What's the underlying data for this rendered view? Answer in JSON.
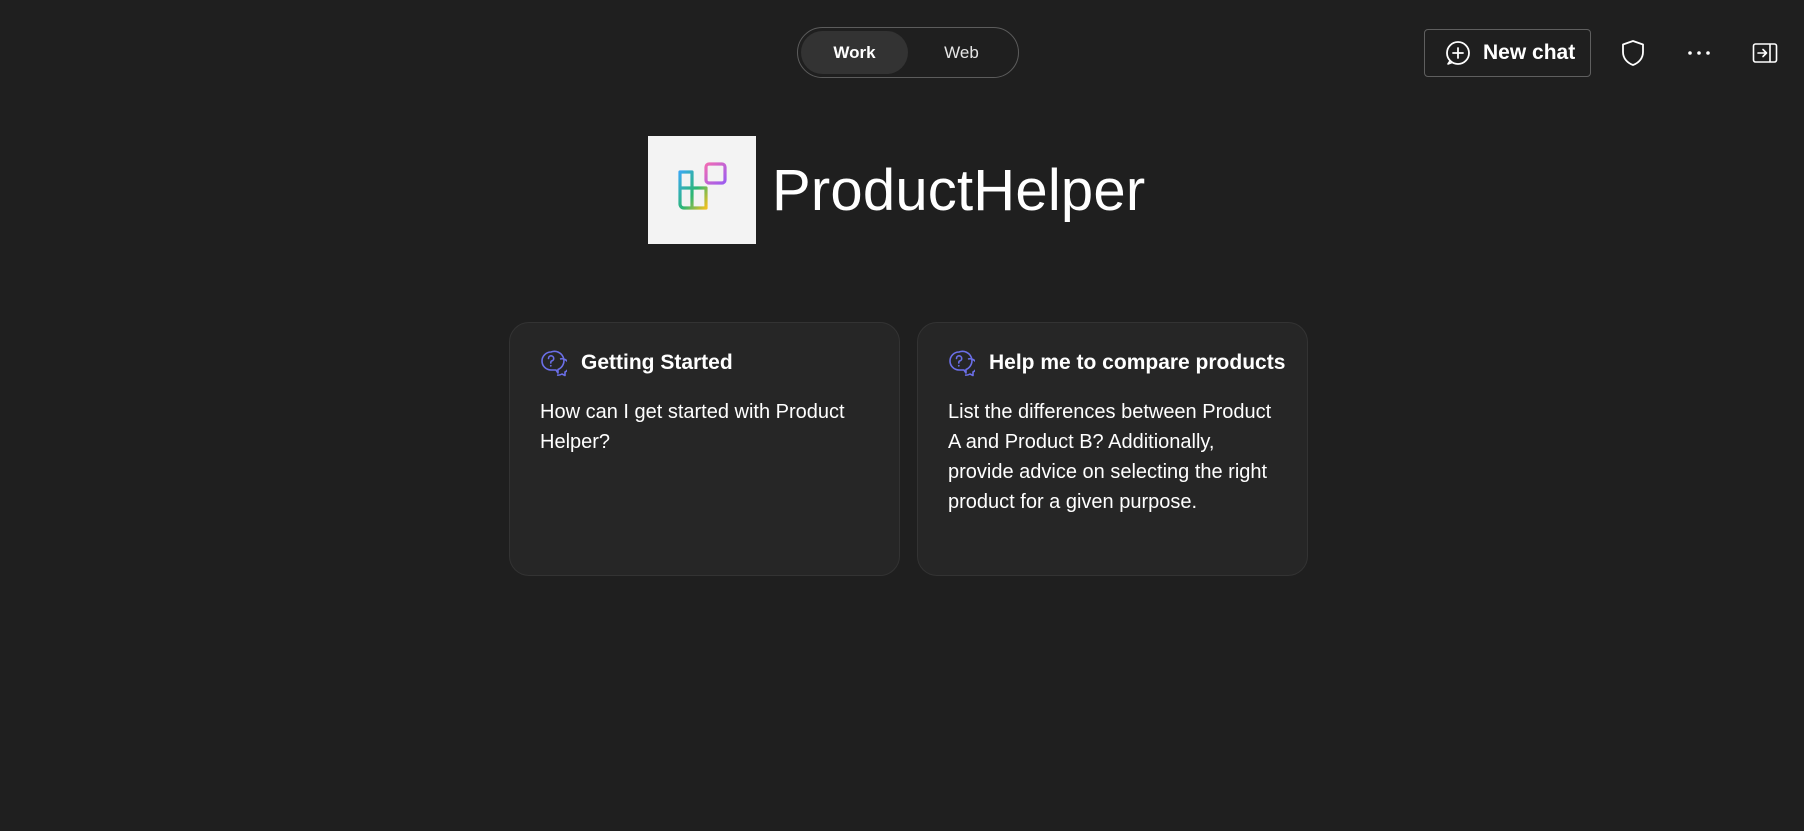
{
  "toggle": {
    "work_label": "Work",
    "web_label": "Web",
    "selected": "Work"
  },
  "toolbar": {
    "new_chat_label": "New chat",
    "icons": [
      "plus-circle-icon",
      "shield-icon",
      "more-icon",
      "open-panel-icon"
    ]
  },
  "brand": {
    "name": "ProductHelper",
    "logo_icon": "app-grid-logo"
  },
  "cards": [
    {
      "icon": "chat-help-icon",
      "title": "Getting Started",
      "body": "How can I get started with Product Helper?"
    },
    {
      "icon": "chat-help-icon",
      "title": "Help me to compare products",
      "body": "List the differences between Product A and Product B? Additionally, provide advice on selecting the right product for a given purpose."
    }
  ],
  "colors": {
    "background": "#1f1f1f",
    "card_background": "#262626",
    "card_icon": "#6b6fe8",
    "toggle_active": "#333333"
  }
}
